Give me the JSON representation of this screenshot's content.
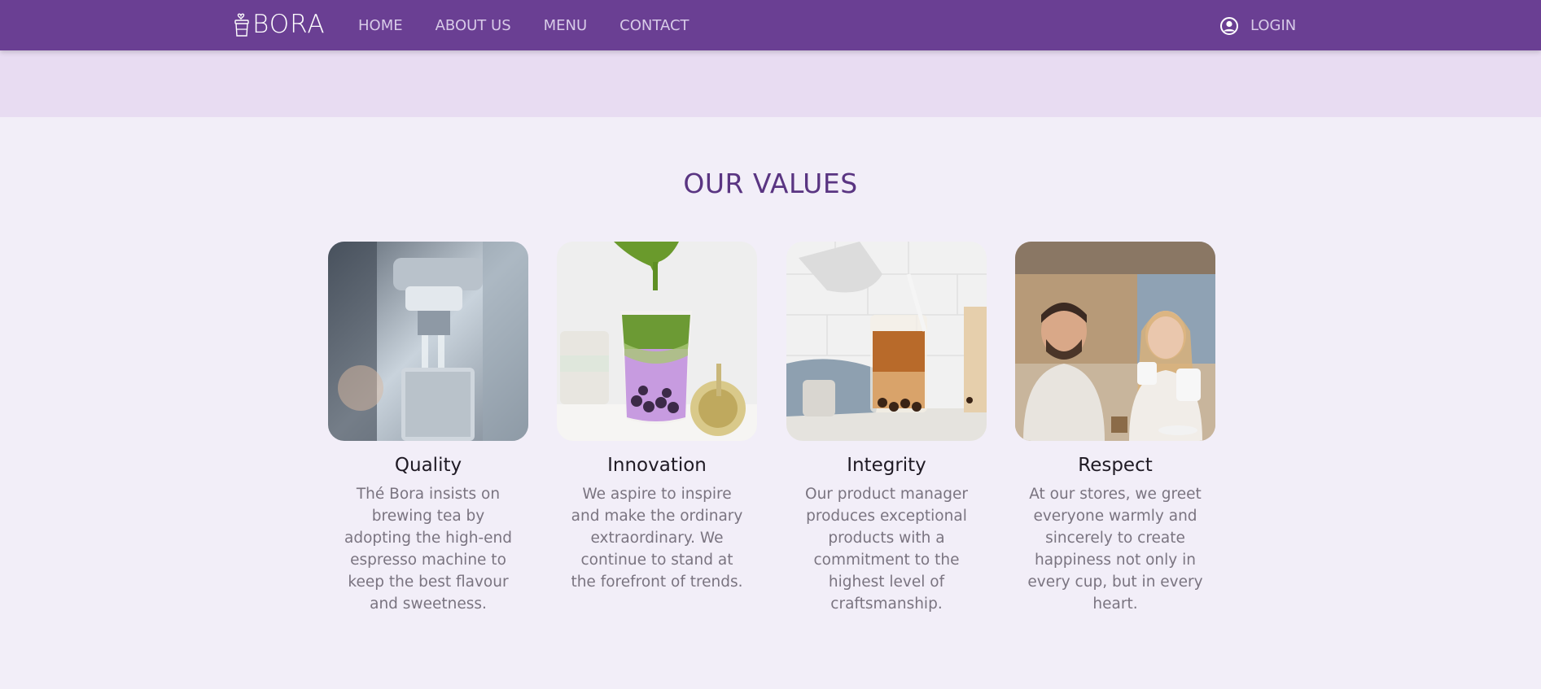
{
  "brand": {
    "logo_text": "BORA",
    "color": "#6a3f93"
  },
  "nav": {
    "items": [
      {
        "label": "HOME"
      },
      {
        "label": "ABOUT US"
      },
      {
        "label": "MENU"
      },
      {
        "label": "CONTACT"
      }
    ],
    "login_label": "LOGIN",
    "login_icon": "user-circle-icon"
  },
  "values": {
    "title": "OUR VALUES",
    "cards": [
      {
        "title": "Quality",
        "text": "Thé Bora insists on brewing tea by adopting the high-end espresso machine to keep the best flavour and sweetness.",
        "image": "espresso-machine-photo"
      },
      {
        "title": "Innovation",
        "text": "We aspire to inspire and make the ordinary extraordinary. We continue to stand at the forefront of trends.",
        "image": "matcha-drink-photo"
      },
      {
        "title": "Integrity",
        "text": "Our product manager produces exceptional products with a commitment to the highest level of craftsmanship.",
        "image": "bubble-tea-photo"
      },
      {
        "title": "Respect",
        "text": "At our stores, we greet everyone warmly and sincerely to create happiness not only in every cup, but in every heart.",
        "image": "cafe-people-photo"
      }
    ]
  }
}
